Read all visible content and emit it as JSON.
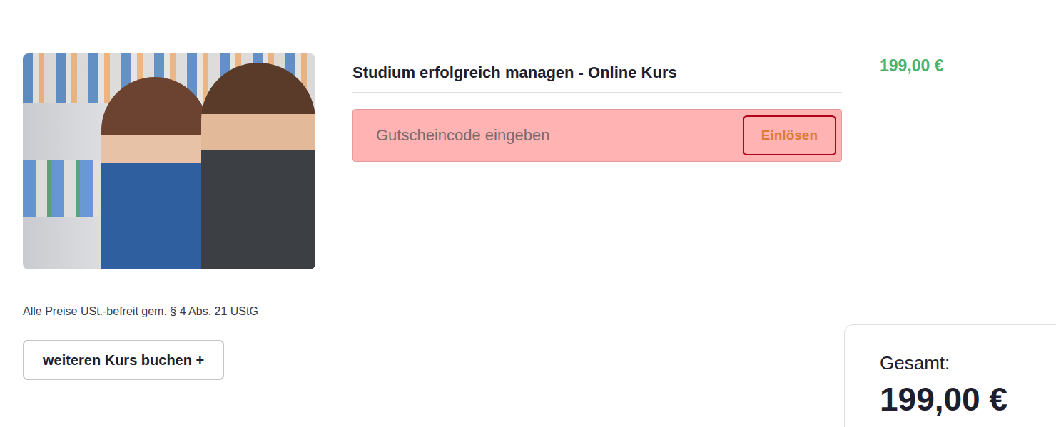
{
  "product": {
    "title": "Studium erfolgreich managen - Online Kurs",
    "price": "199,00 €",
    "voucher": {
      "placeholder": "Gutscheincode eingeben",
      "button": "Einlösen",
      "error": true
    }
  },
  "tax_note": "Alle Preise USt.-befreit gem. § 4 Abs. 21 UStG",
  "add_course_button": "weiteren Kurs buchen +",
  "total": {
    "label": "Gesamt:",
    "amount": "199,00 €"
  }
}
